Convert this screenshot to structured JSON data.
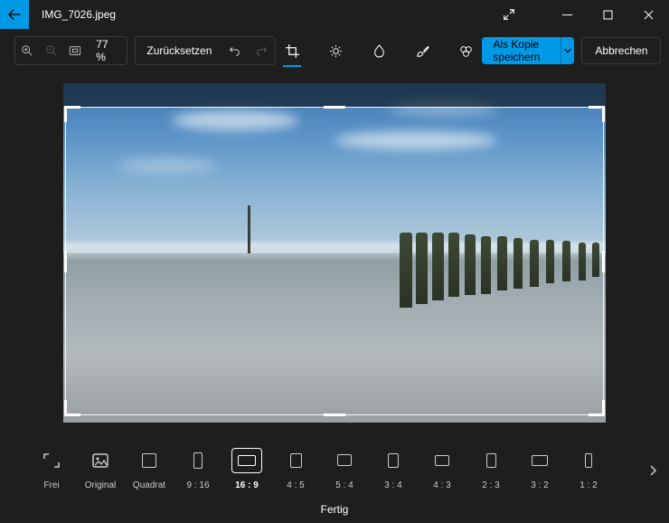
{
  "titlebar": {
    "filename": "IMG_7026.jpeg"
  },
  "toolbar": {
    "zoom_text": "77 %",
    "reset_label": "Zurücksetzen",
    "save_label": "Als Kopie speichern",
    "cancel_label": "Abbrechen"
  },
  "ratios": {
    "items": [
      {
        "label": "Frei",
        "w": 18,
        "h": 14
      },
      {
        "label": "Original",
        "w": 16,
        "h": 16
      },
      {
        "label": "Quadrat",
        "w": 16,
        "h": 16
      },
      {
        "label": "9 : 16",
        "w": 10,
        "h": 18
      },
      {
        "label": "16 : 9",
        "w": 20,
        "h": 12
      },
      {
        "label": "4 : 5",
        "w": 13,
        "h": 16
      },
      {
        "label": "5 : 4",
        "w": 16,
        "h": 13
      },
      {
        "label": "3 : 4",
        "w": 12,
        "h": 16
      },
      {
        "label": "4 : 3",
        "w": 16,
        "h": 12
      },
      {
        "label": "2 : 3",
        "w": 11,
        "h": 16
      },
      {
        "label": "3 : 2",
        "w": 18,
        "h": 12
      },
      {
        "label": "1 : 2",
        "w": 8,
        "h": 16
      }
    ],
    "active_index": 4
  },
  "footer": {
    "done_label": "Fertig"
  }
}
